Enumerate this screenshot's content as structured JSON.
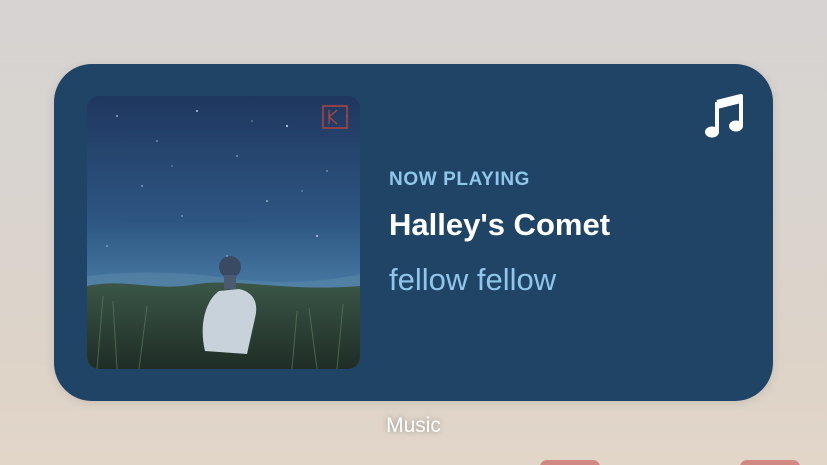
{
  "widget": {
    "header_label": "NOW PLAYING",
    "track_title": "Halley's Comet",
    "artist": "fellow fellow",
    "app_icon": "music-note-icon",
    "artwork": "album-artwork",
    "colors": {
      "background": "#1f4466",
      "accent": "#8fc6ea",
      "title": "#ffffff"
    }
  },
  "app": {
    "label": "Music"
  }
}
